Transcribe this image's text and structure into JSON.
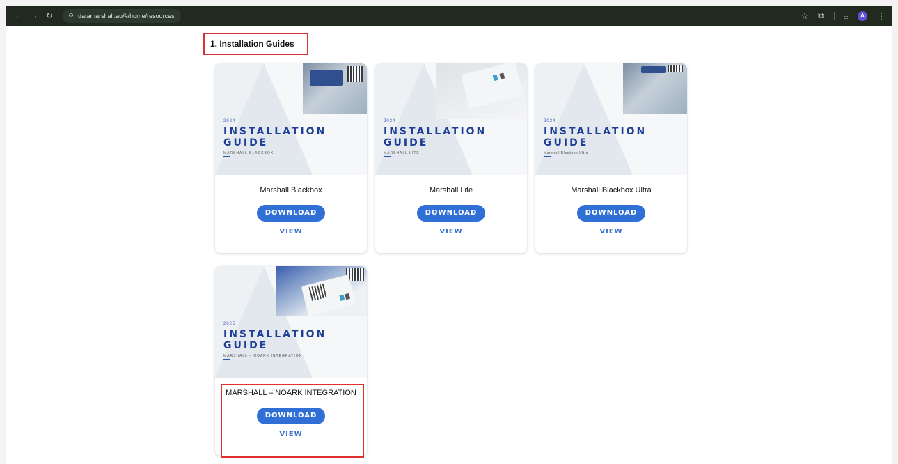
{
  "browser": {
    "url": "datamarshall.au/#/home/resources",
    "avatar_letter": "A"
  },
  "section": {
    "title": "1. Installation Guides"
  },
  "cards": [
    {
      "year": "2024",
      "cover_line1": "INSTALLATION",
      "cover_line2": "GUIDE",
      "cover_subtitle": "MARSHALL BLACKBOX",
      "title": "Marshall Blackbox",
      "download_label": "DOWNLOAD",
      "view_label": "VIEW"
    },
    {
      "year": "2024",
      "cover_line1": "INSTALLATION",
      "cover_line2": "GUIDE",
      "cover_subtitle": "MARSHALL LITE",
      "title": "Marshall Lite",
      "download_label": "DOWNLOAD",
      "view_label": "VIEW"
    },
    {
      "year": "2024",
      "cover_line1": "INSTALLATION",
      "cover_line2": "GUIDE",
      "cover_subtitle": "Marshall Blackbox Ultra",
      "title": "Marshall Blackbox Ultra",
      "download_label": "DOWNLOAD",
      "view_label": "VIEW"
    },
    {
      "year": "2025",
      "cover_line1": "INSTALLATION",
      "cover_line2": "GUIDE",
      "cover_subtitle": "MARSHALL – NOARK INTEGRATION",
      "title": "MARSHALL – NOARK INTEGRATION",
      "download_label": "DOWNLOAD",
      "view_label": "VIEW"
    }
  ],
  "colors": {
    "accent": "#2f6fd6",
    "highlight": "#e03030",
    "cover_text": "#1f3f97"
  }
}
